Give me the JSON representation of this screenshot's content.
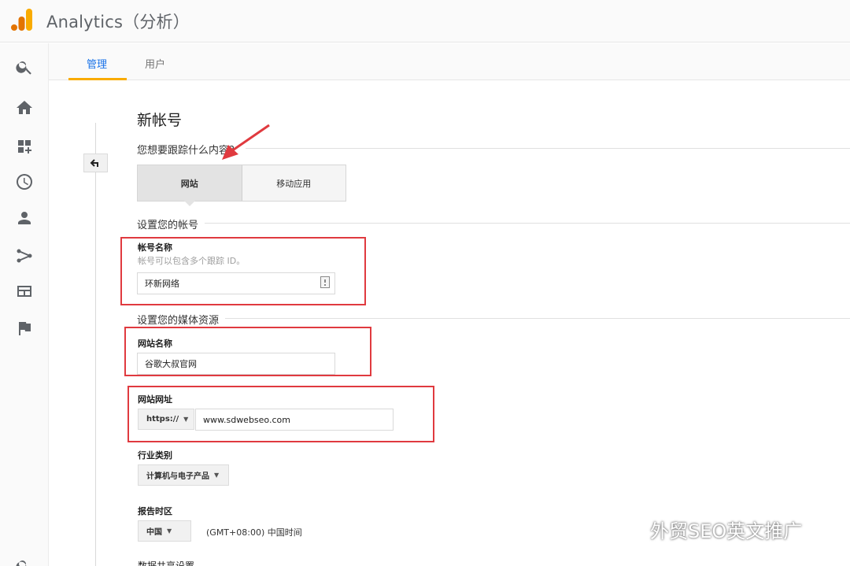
{
  "app": {
    "title": "Analytics（分析）"
  },
  "tabs": [
    {
      "label": "管理",
      "active": true
    },
    {
      "label": "用户",
      "active": false
    }
  ],
  "nav_icons": [
    "search-icon",
    "home-icon",
    "dashboard-add-icon",
    "clock-icon",
    "person-icon",
    "acquisition-icon",
    "behavior-icon",
    "flag-icon",
    "search-icon"
  ],
  "form": {
    "title": "新帐号",
    "track_question": "您想要跟踪什么内容？",
    "track_options": [
      "网站",
      "移动应用"
    ],
    "track_selected": "网站",
    "account_section": "设置您的帐号",
    "account_name_label": "帐号名称",
    "account_name_help": "帐号可以包含多个跟踪 ID。",
    "account_name_value": "环新网络",
    "property_section": "设置您的媒体资源",
    "website_name_label": "网站名称",
    "website_name_value": "谷歌大叔官网",
    "website_url_label": "网站网址",
    "protocol_value": "https://",
    "website_url_value": "www.sdwebseo.com",
    "industry_label": "行业类别",
    "industry_value": "计算机与电子产品",
    "timezone_label": "报告时区",
    "timezone_country": "中国",
    "timezone_value": "(GMT+08:00) 中国时间",
    "data_sharing_label": "数据共享设置"
  },
  "watermark": {
    "text": "外贸SEO英文推广"
  },
  "colors": {
    "accent": "#1a73e8",
    "tab_underline": "#f9ab00",
    "highlight": "#e03a3f",
    "logo_orange": "#f9ab00",
    "logo_dark": "#e37400"
  }
}
